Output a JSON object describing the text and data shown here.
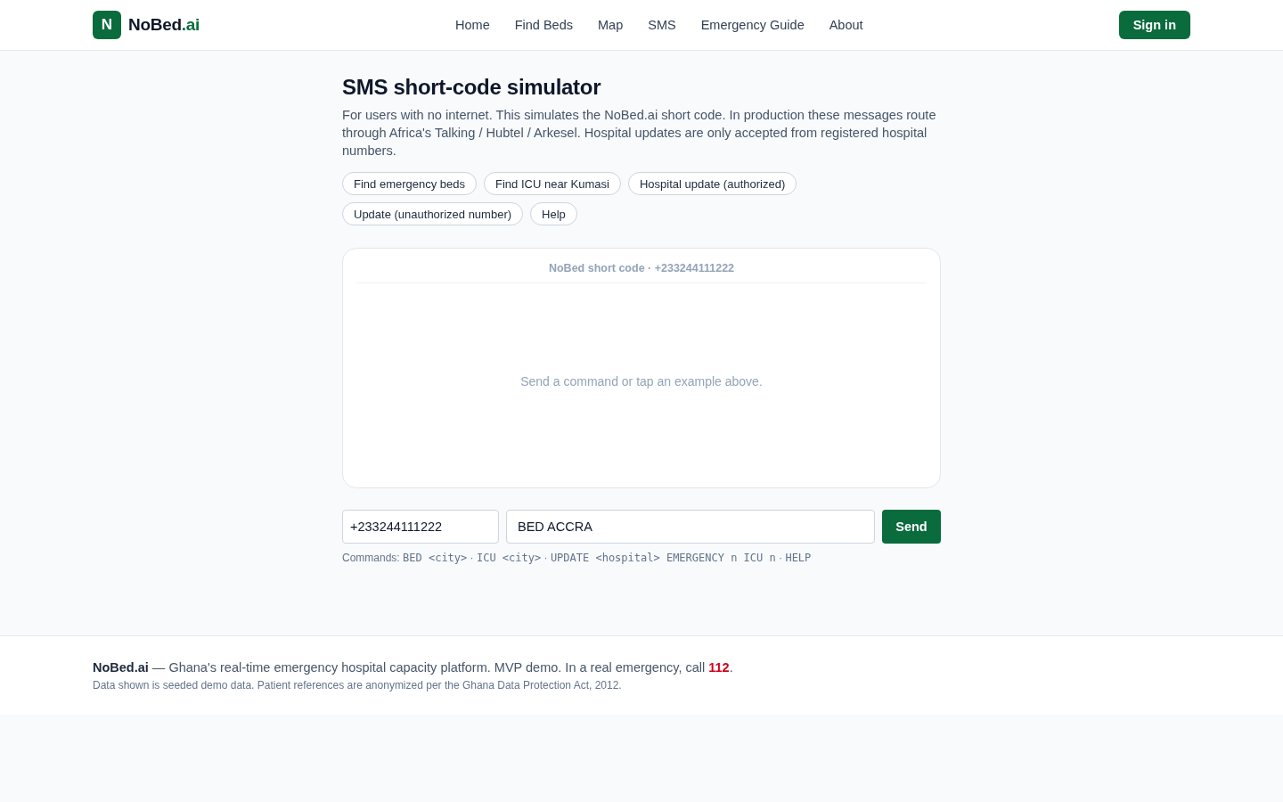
{
  "header": {
    "logo": {
      "mark": "N",
      "name": "NoBed",
      "suffix": ".ai"
    },
    "nav": [
      "Home",
      "Find Beds",
      "Map",
      "SMS",
      "Emergency Guide",
      "About"
    ],
    "sign_in": "Sign in"
  },
  "page": {
    "title": "SMS short-code simulator",
    "description": "For users with no internet. This simulates the NoBed.ai short code. In production these messages route through Africa's Talking / Hubtel / Arkesel. Hospital updates are only accepted from registered hospital numbers.",
    "examples": [
      "Find emergency beds",
      "Find ICU near Kumasi",
      "Hospital update (authorized)",
      "Update (unauthorized number)",
      "Help"
    ]
  },
  "chat": {
    "header": "NoBed short code · +233244111222",
    "empty_message": "Send a command or tap an example above."
  },
  "composer": {
    "phone": {
      "value": "+233244111222"
    },
    "message": {
      "value": "BED ACCRA"
    },
    "send": "Send"
  },
  "commands_hint": {
    "label": "Commands:",
    "separator": "·",
    "commands": [
      "BED <city>",
      "ICU <city>",
      "UPDATE <hospital> EMERGENCY n ICU n",
      "HELP"
    ]
  },
  "footer": {
    "text": "**NoBed.ai** — Ghana's real-time emergency hospital capacity platform. MVP demo. In a real emergency, call **112**.",
    "note": "Data shown is seeded demo data. Patient references are anonymized per the Ghana Data Protection Act, 2012."
  }
}
